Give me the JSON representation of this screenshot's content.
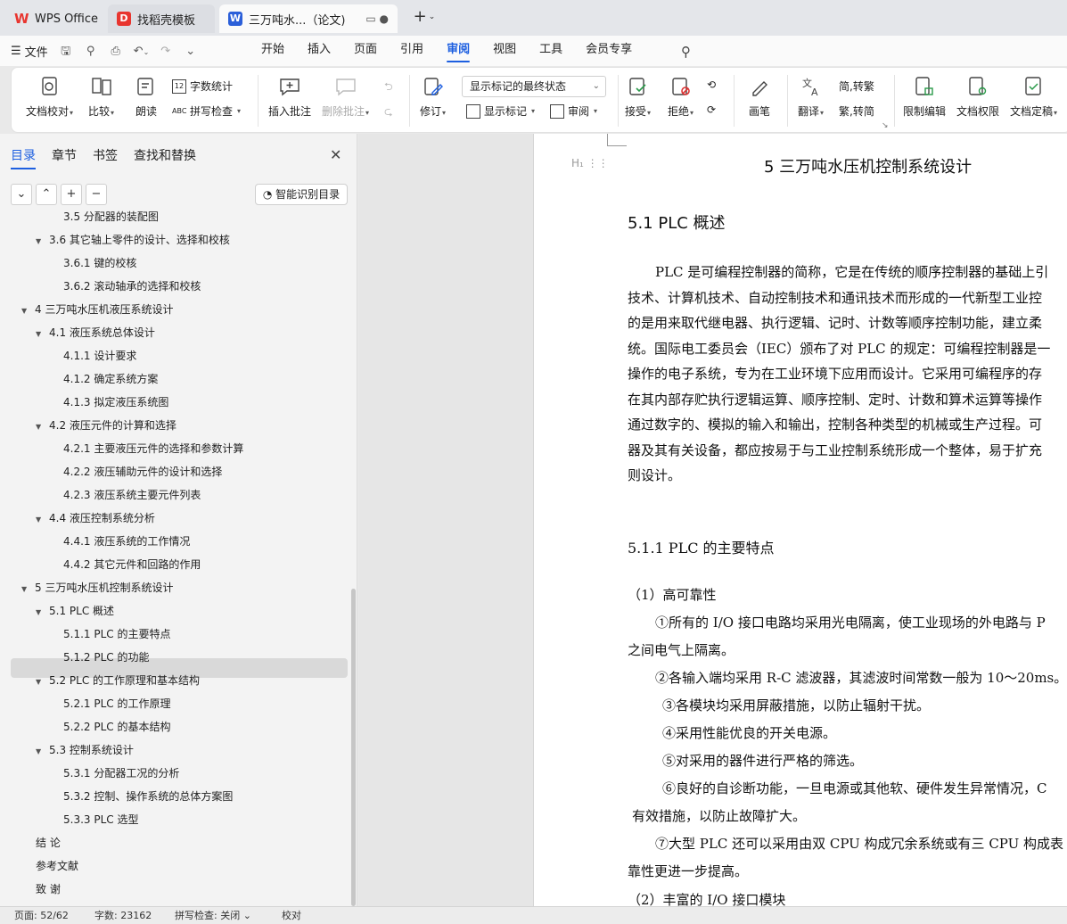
{
  "tabs": {
    "wps": "WPS Office",
    "template": "找稻壳模板",
    "doc": "三万吨水...（论文)"
  },
  "menu": {
    "file": "文件",
    "tabs": [
      "开始",
      "插入",
      "页面",
      "引用",
      "审阅",
      "视图",
      "工具",
      "会员专享"
    ],
    "active_tab": "审阅"
  },
  "ribbon": {
    "doc_check": "文档校对",
    "compare": "比较",
    "read_aloud": "朗读",
    "word_count": "字数统计",
    "spell_check": "拼写检查",
    "insert_comment": "插入批注",
    "delete_comment": "删除批注",
    "revise": "修订",
    "markup_state": "显示标记的最终状态",
    "show_markup": "显示标记",
    "review": "审阅",
    "accept": "接受",
    "reject": "拒绝",
    "pen": "画笔",
    "translate": "翻译",
    "to_traditional": "简,转繁",
    "to_simplified": "繁,转简",
    "restrict_edit": "限制编辑",
    "doc_permission": "文档权限",
    "doc_finalize": "文档定稿"
  },
  "nav": {
    "tabs": [
      "目录",
      "章节",
      "书签",
      "查找和替换"
    ],
    "smart_toc": "智能识别目录",
    "toc": [
      {
        "text": "3.5  分配器的装配图",
        "level": 3,
        "arrow": false
      },
      {
        "text": "3.6  其它轴上零件的设计、选择和校核",
        "level": 2,
        "arrow": true
      },
      {
        "text": "3.6.1  键的校核",
        "level": 3,
        "arrow": false
      },
      {
        "text": "3.6.2  滚动轴承的选择和校核",
        "level": 3,
        "arrow": false
      },
      {
        "text": "4  三万吨水压机液压系统设计",
        "level": 1,
        "arrow": true
      },
      {
        "text": "4.1  液压系统总体设计",
        "level": 2,
        "arrow": true
      },
      {
        "text": "4.1.1  设计要求",
        "level": 3,
        "arrow": false
      },
      {
        "text": "4.1.2  确定系统方案",
        "level": 3,
        "arrow": false
      },
      {
        "text": "4.1.3  拟定液压系统图",
        "level": 3,
        "arrow": false
      },
      {
        "text": "4.2  液压元件的计算和选择",
        "level": 2,
        "arrow": true
      },
      {
        "text": "4.2.1  主要液压元件的选择和参数计算",
        "level": 3,
        "arrow": false
      },
      {
        "text": "4.2.2  液压辅助元件的设计和选择",
        "level": 3,
        "arrow": false
      },
      {
        "text": "4.2.3 液压系统主要元件列表",
        "level": 3,
        "arrow": false
      },
      {
        "text": "4.4  液压控制系统分析",
        "level": 2,
        "arrow": true
      },
      {
        "text": "4.4.1  液压系统的工作情况",
        "level": 3,
        "arrow": false
      },
      {
        "text": "4.4.2 其它元件和回路的作用",
        "level": 3,
        "arrow": false
      },
      {
        "text": "5  三万吨水压机控制系统设计",
        "level": 1,
        "arrow": true
      },
      {
        "text": "5.1 PLC 概述",
        "level": 2,
        "arrow": true
      },
      {
        "text": "5.1.1 PLC 的主要特点",
        "level": 3,
        "arrow": false
      },
      {
        "text": "5.1.2 PLC 的功能",
        "level": 3,
        "arrow": false
      },
      {
        "text": "5.2 PLC 的工作原理和基本结构",
        "level": 2,
        "arrow": true
      },
      {
        "text": "5.2.1 PLC 的工作原理",
        "level": 3,
        "arrow": false
      },
      {
        "text": "5.2.2 PLC 的基本结构",
        "level": 3,
        "arrow": false
      },
      {
        "text": "5.3  控制系统设计",
        "level": 2,
        "arrow": true
      },
      {
        "text": "5.3.1 分配器工况的分析",
        "level": 3,
        "arrow": false
      },
      {
        "text": "5.3.2  控制、操作系统的总体方案图",
        "level": 3,
        "arrow": false
      },
      {
        "text": "5.3.3 PLC 选型",
        "level": 3,
        "arrow": false
      },
      {
        "text": "结    论",
        "level": 1,
        "arrow": false
      },
      {
        "text": "参考文献",
        "level": 1,
        "arrow": false
      },
      {
        "text": "致    谢",
        "level": 1,
        "arrow": false
      }
    ]
  },
  "document": {
    "heading_marker": "H₁",
    "chapter_title": "5  三万吨水压机控制系统设计",
    "section_title": "5.1 PLC 概述",
    "paragraph": [
      "PLC 是可编程控制器的简称，它是在传统的顺序控制器的基础上引",
      "技术、计算机技术、自动控制技术和通讯技术而形成的一代新型工业控",
      "的是用来取代继电器、执行逻辑、记时、计数等顺序控制功能，建立柔",
      "统。国际电工委员会（IEC）颁布了对 PLC 的规定：可编程控制器是一",
      "操作的电子系统，专为在工业环境下应用而设计。它采用可编程序的存",
      "在其内部存贮执行逻辑运算、顺序控制、定时、计数和算术运算等操作",
      "通过数字的、模拟的输入和输出，控制各种类型的机械或生产过程。可",
      "器及其有关设备，都应按易于与工业控制系统形成一个整体，易于扩充",
      "则设计。"
    ],
    "subsection_title": "5.1.1 PLC 的主要特点",
    "features": [
      "（1）高可靠性",
      "①所有的 I/O 接口电路均采用光电隔离，使工业现场的外电路与 P",
      "之间电气上隔离。",
      "②各输入端均采用 R-C 滤波器，其滤波时间常数一般为 10～20ms。",
      "③各模块均采用屏蔽措施，以防止辐射干扰。",
      "④采用性能优良的开关电源。",
      "⑤对采用的器件进行严格的筛选。",
      "⑥良好的自诊断功能，一旦电源或其他软、硬件发生异常情况，C",
      "有效措施，以防止故障扩大。",
      "⑦大型 PLC 还可以采用由双 CPU 构成冗余系统或有三 CPU 构成表",
      "靠性更进一步提高。",
      "（2）丰富的 I/O 接口模块"
    ]
  },
  "status": {
    "page": "页面: 52/62",
    "words": "字数: 23162",
    "spell": "拼写检查: 关闭",
    "proof": "校对"
  },
  "colors": {
    "accent": "#1d5fe0",
    "wps_red": "#e8352f",
    "doc_blue": "#2b5fd9"
  }
}
